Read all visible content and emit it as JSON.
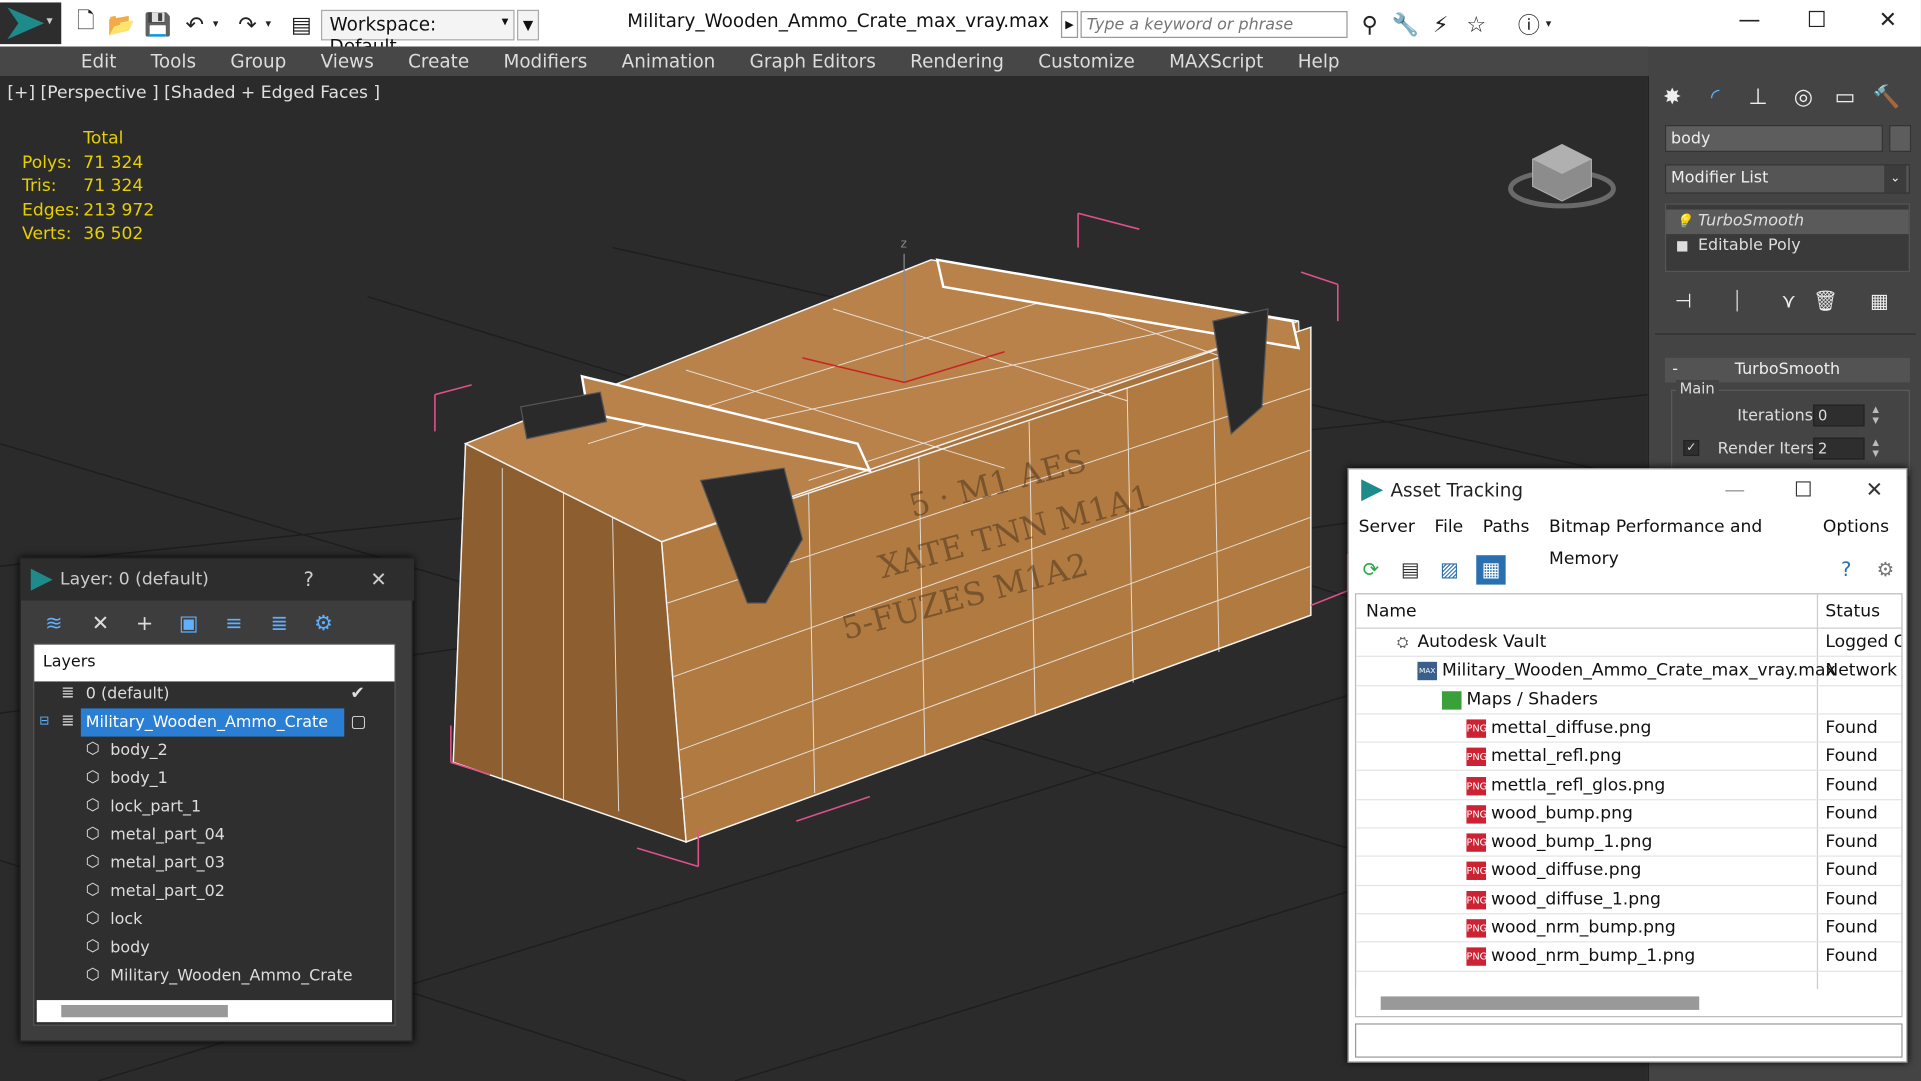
{
  "title_bar": {
    "workspace": "Workspace: Default",
    "window_title": "Military_Wooden_Ammo_Crate_max_vray.max",
    "search_placeholder": "Type a keyword or phrase"
  },
  "menu": [
    "Edit",
    "Tools",
    "Group",
    "Views",
    "Create",
    "Modifiers",
    "Animation",
    "Graph Editors",
    "Rendering",
    "Customize",
    "MAXScript",
    "Help"
  ],
  "viewport": {
    "label": "[+] [Perspective ] [Shaded + Edged Faces ]",
    "stats": {
      "header": "Total",
      "rows": [
        {
          "k": "Polys:",
          "v": "71 324"
        },
        {
          "k": "Tris:",
          "v": "71 324"
        },
        {
          "k": "Edges:",
          "v": "213 972"
        },
        {
          "k": "Verts:",
          "v": "36 502"
        }
      ]
    },
    "axis_z": "z"
  },
  "command_panel": {
    "object_name": "body",
    "modifier_list": "Modifier List",
    "stack": [
      "TurboSmooth",
      "Editable Poly"
    ],
    "rollout_title": "TurboSmooth",
    "group_main": "Main",
    "iterations_label": "Iterations:",
    "iterations_value": "0",
    "render_iters_label": "Render Iters:",
    "render_iters_value": "2"
  },
  "layer_window": {
    "title": "Layer: 0 (default)",
    "help": "?",
    "column_header": "Layers",
    "rows": [
      {
        "name": "0 (default)",
        "level": 0,
        "selected": false
      },
      {
        "name": "Military_Wooden_Ammo_Crate",
        "level": 0,
        "selected": true
      },
      {
        "name": "body_2",
        "level": 1
      },
      {
        "name": "body_1",
        "level": 1
      },
      {
        "name": "lock_part_1",
        "level": 1
      },
      {
        "name": "metal_part_04",
        "level": 1
      },
      {
        "name": "metal_part_03",
        "level": 1
      },
      {
        "name": "metal_part_02",
        "level": 1
      },
      {
        "name": "lock",
        "level": 1
      },
      {
        "name": "body",
        "level": 1
      },
      {
        "name": "Military_Wooden_Ammo_Crate",
        "level": 1
      }
    ]
  },
  "asset_window": {
    "title": "Asset Tracking",
    "menu": [
      "Server",
      "File",
      "Paths",
      "Bitmap Performance and Memory",
      "Options"
    ],
    "col_name": "Name",
    "col_status": "Status",
    "rows": [
      {
        "name": "Autodesk Vault",
        "status": "Logged O",
        "indent": 1,
        "icon": "vault"
      },
      {
        "name": "Military_Wooden_Ammo_Crate_max_vray.max",
        "status": "Network F",
        "indent": 2,
        "icon": "max"
      },
      {
        "name": "Maps / Shaders",
        "status": "",
        "indent": 3,
        "icon": "folder"
      },
      {
        "name": "mettal_diffuse.png",
        "status": "Found",
        "indent": 4,
        "icon": "png"
      },
      {
        "name": "mettal_refl.png",
        "status": "Found",
        "indent": 4,
        "icon": "png"
      },
      {
        "name": "mettla_refl_glos.png",
        "status": "Found",
        "indent": 4,
        "icon": "png"
      },
      {
        "name": "wood_bump.png",
        "status": "Found",
        "indent": 4,
        "icon": "png"
      },
      {
        "name": "wood_bump_1.png",
        "status": "Found",
        "indent": 4,
        "icon": "png"
      },
      {
        "name": "wood_diffuse.png",
        "status": "Found",
        "indent": 4,
        "icon": "png"
      },
      {
        "name": "wood_diffuse_1.png",
        "status": "Found",
        "indent": 4,
        "icon": "png"
      },
      {
        "name": "wood_nrm_bump.png",
        "status": "Found",
        "indent": 4,
        "icon": "png"
      },
      {
        "name": "wood_nrm_bump_1.png",
        "status": "Found",
        "indent": 4,
        "icon": "png"
      }
    ],
    "png_badge": "PNG",
    "max_badge": "MAX"
  },
  "colors": {
    "stats_yellow": "#e6d000",
    "selection_blue": "#2a7fd4",
    "wood": "#a9743d",
    "bbox_pink": "#e0508a"
  }
}
